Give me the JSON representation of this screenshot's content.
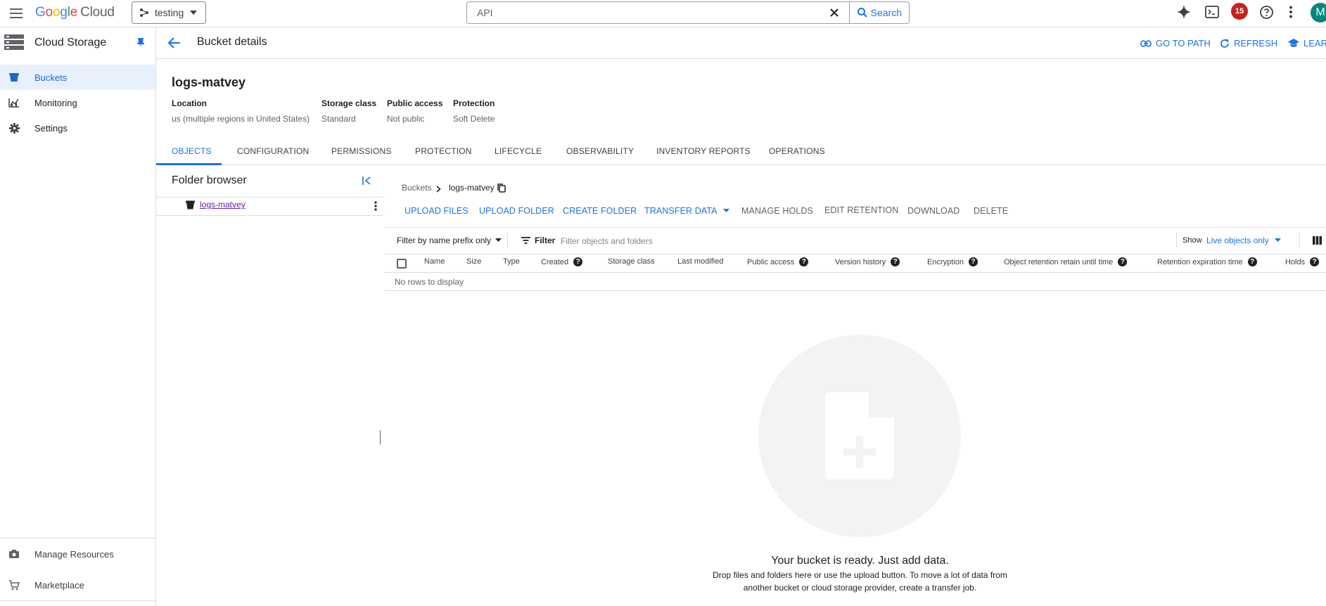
{
  "topbar": {
    "logo_google": [
      "G",
      "o",
      "o",
      "g",
      "l",
      "e"
    ],
    "logo_cloud": "Cloud",
    "project": "testing",
    "search_placeholder": "API",
    "search_button": "Search",
    "notifications_count": "15",
    "avatar_initial": "M"
  },
  "sidebar": {
    "title": "Cloud Storage",
    "items": [
      {
        "label": "Buckets",
        "icon": "bucket-icon"
      },
      {
        "label": "Monitoring",
        "icon": "monitoring-icon"
      },
      {
        "label": "Settings",
        "icon": "gear-icon"
      }
    ],
    "bottom_items": [
      {
        "label": "Manage Resources",
        "icon": "manage-resources-icon"
      },
      {
        "label": "Marketplace",
        "icon": "cart-icon"
      }
    ]
  },
  "header": {
    "title": "Bucket details",
    "actions": {
      "go_to_path": "GO TO PATH",
      "refresh": "REFRESH",
      "learn": "LEARN"
    }
  },
  "bucket": {
    "name": "logs-matvey",
    "details": [
      {
        "label": "Location",
        "value": "us (multiple regions in United States)"
      },
      {
        "label": "Storage class",
        "value": "Standard"
      },
      {
        "label": "Public access",
        "value": "Not public"
      },
      {
        "label": "Protection",
        "value": "Soft Delete"
      }
    ]
  },
  "tabs": [
    "OBJECTS",
    "CONFIGURATION",
    "PERMISSIONS",
    "PROTECTION",
    "LIFECYCLE",
    "OBSERVABILITY",
    "INVENTORY REPORTS",
    "OPERATIONS"
  ],
  "folder_browser": {
    "title": "Folder browser",
    "root": "logs-matvey"
  },
  "breadcrumb": {
    "root": "Buckets",
    "current": "logs-matvey"
  },
  "object_actions": {
    "upload_files": "UPLOAD FILES",
    "upload_folder": "UPLOAD FOLDER",
    "create_folder": "CREATE FOLDER",
    "transfer_data": "TRANSFER DATA",
    "manage_holds": "MANAGE HOLDS",
    "edit_retention": "EDIT RETENTION",
    "download": "DOWNLOAD",
    "delete": "DELETE"
  },
  "filter": {
    "mode": "Filter by name prefix only",
    "label": "Filter",
    "placeholder": "Filter objects and folders",
    "show_label": "Show",
    "show_value": "Live objects only"
  },
  "table": {
    "columns": [
      "Name",
      "Size",
      "Type",
      "Created",
      "Storage class",
      "Last modified",
      "Public access",
      "Version history",
      "Encryption",
      "Object retention retain until time",
      "Retention expiration time",
      "Holds"
    ],
    "empty_text": "No rows to display"
  },
  "empty_state": {
    "title": "Your bucket is ready. Just add data.",
    "line1": "Drop files and folders here or use the upload button. To move a lot of data from",
    "line2": "another bucket or cloud storage provider, create a transfer job."
  }
}
